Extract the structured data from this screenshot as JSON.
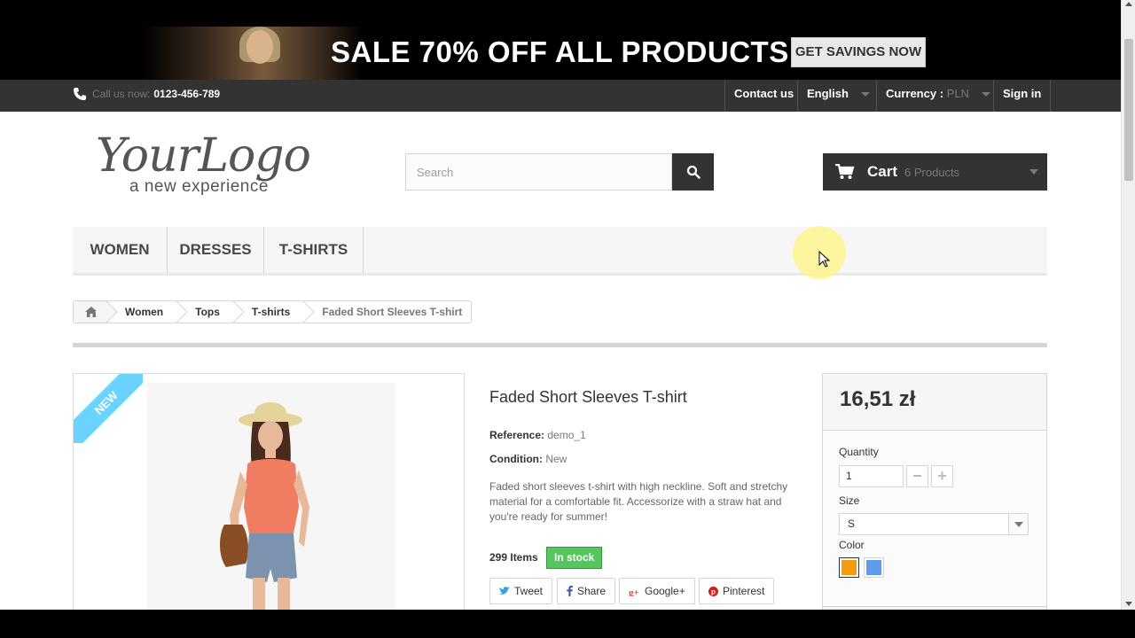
{
  "banner": {
    "headline": "SALE 70% OFF ALL PRODUCTS",
    "button_label": "GET SAVINGS NOW"
  },
  "topnav": {
    "call_label": "Call us now:",
    "phone": "0123-456-789",
    "contact": "Contact us",
    "language": "English",
    "currency_label": "Currency :",
    "currency_value": "PLN",
    "signin": "Sign in"
  },
  "header": {
    "logo_script": "YourLogo",
    "logo_tag": "a new experience",
    "search_placeholder": "Search",
    "cart_label": "Cart",
    "cart_count": "6 Products"
  },
  "menu": {
    "items": [
      {
        "label": "WOMEN"
      },
      {
        "label": "DRESSES"
      },
      {
        "label": "T-SHIRTS"
      }
    ]
  },
  "breadcrumb": {
    "items": [
      {
        "label": "Women"
      },
      {
        "label": "Tops"
      },
      {
        "label": "T-shirts"
      }
    ],
    "current": "Faded Short Sleeves T-shirt"
  },
  "product": {
    "badge": "NEW",
    "name": "Faded Short Sleeves T-shirt",
    "reference_label": "Reference:",
    "reference": "demo_1",
    "condition_label": "Condition:",
    "condition": "New",
    "description": "Faded short sleeves t-shirt with high neckline. Soft and stretchy material for a comfortable fit. Accessorize with a straw hat and you're ready for summer!",
    "items_count": "299 Items",
    "stock_status": "In stock",
    "social": [
      {
        "label": "Tweet",
        "icon": "twitter-icon"
      },
      {
        "label": "Share",
        "icon": "facebook-icon"
      },
      {
        "label": "Google+",
        "icon": "google-plus-icon"
      },
      {
        "label": "Pinterest",
        "icon": "pinterest-icon"
      }
    ]
  },
  "buy": {
    "price": "16,51 zł",
    "quantity_label": "Quantity",
    "quantity": "1",
    "size_label": "Size",
    "size_value": "S",
    "color_label": "Color",
    "colors": [
      "#f39c11",
      "#5d9cec"
    ]
  }
}
